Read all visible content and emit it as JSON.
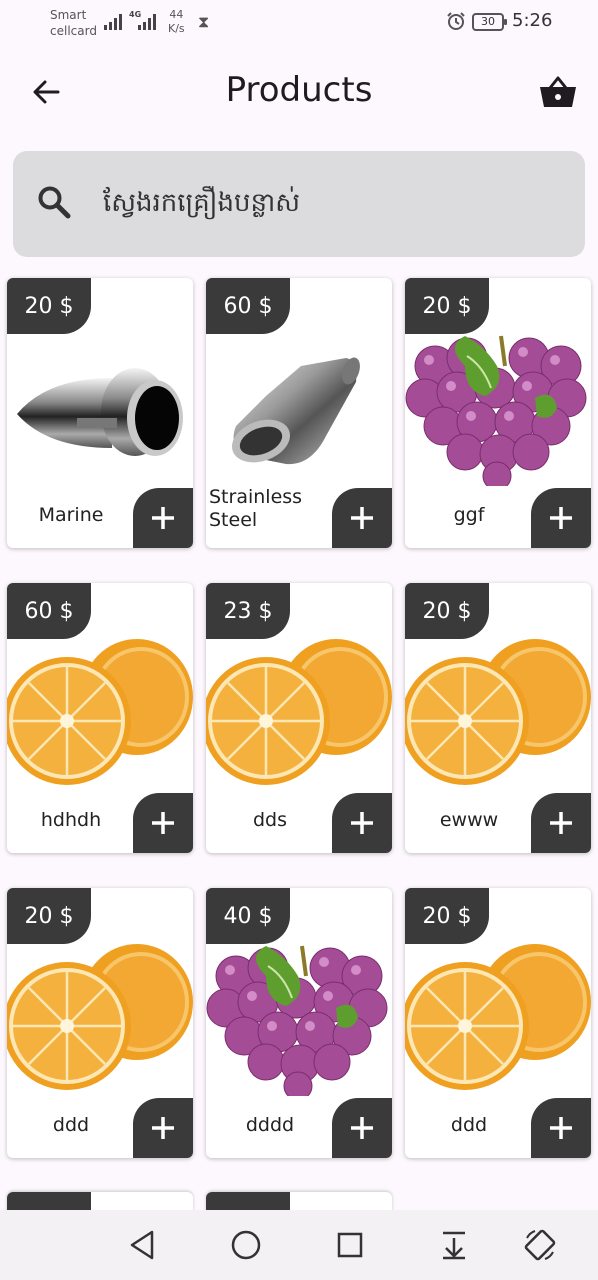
{
  "status_bar": {
    "carrier_line1": "Smart",
    "carrier_line2": "cellcard",
    "network": "4G",
    "speed_value": "44",
    "speed_unit": "K/s",
    "battery": "30",
    "time": "5:26"
  },
  "app_bar": {
    "title": "Products",
    "back_icon": "arrow-left-icon",
    "cart_icon": "basket-icon"
  },
  "search": {
    "placeholder": "ស្វែងរកគ្រឿងបន្លាស់",
    "icon": "search-icon"
  },
  "products": [
    {
      "price": "20 $",
      "name": "Marine",
      "image": "exhaust-tip"
    },
    {
      "price": "60 $",
      "name": "Strainless Steel",
      "image": "steel-muffler"
    },
    {
      "price": "20 $",
      "name": "ggf",
      "image": "grapes"
    },
    {
      "price": "60 $",
      "name": "hdhdh",
      "image": "orange"
    },
    {
      "price": "23 $",
      "name": "dds",
      "image": "orange"
    },
    {
      "price": "20 $",
      "name": "ewww",
      "image": "orange"
    },
    {
      "price": "20 $",
      "name": "ddd",
      "image": "orange"
    },
    {
      "price": "40 $",
      "name": "dddd",
      "image": "grapes"
    },
    {
      "price": "20 $",
      "name": "ddd",
      "image": "orange"
    }
  ],
  "nav_bar": {
    "icons": [
      "back-triangle-icon",
      "home-circle-icon",
      "recents-square-icon",
      "notification-pull-icon",
      "rotate-icon"
    ]
  },
  "colors": {
    "accent_dark": "#3a3a3a",
    "background": "#fdf8fd",
    "search_bg": "#dcdbdd"
  }
}
